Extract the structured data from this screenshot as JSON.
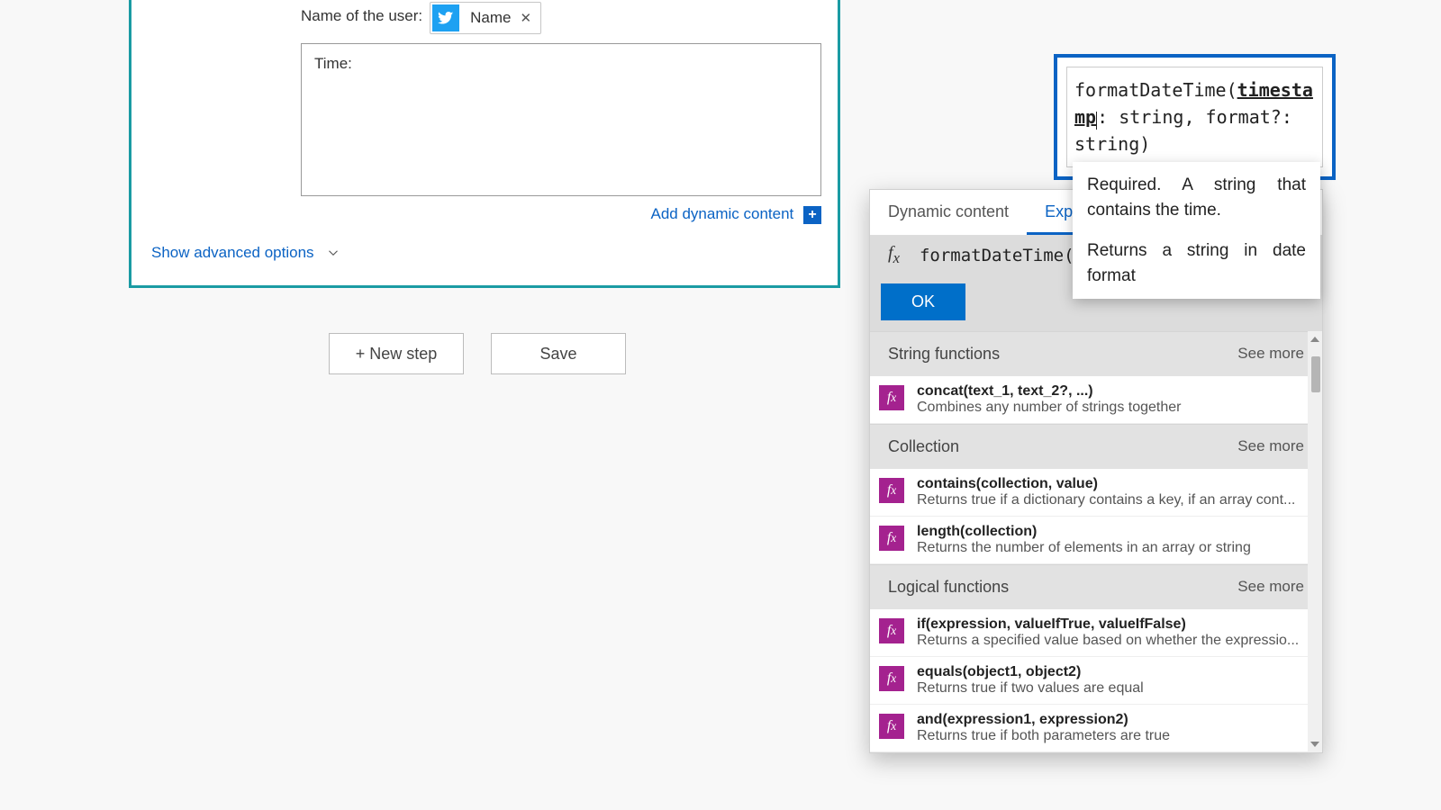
{
  "card": {
    "user_label": "Name of the user:",
    "token_label": "Name",
    "time_label": "Time:",
    "dyn_link": "Add dynamic content",
    "advanced": "Show advanced options"
  },
  "buttons": {
    "new_step": "+ New step",
    "save": "Save"
  },
  "panel": {
    "tab_dynamic": "Dynamic content",
    "tab_expression": "Expression",
    "expr_value": "formatDateTime(",
    "ok": "OK",
    "see_more": "See more",
    "groups": [
      {
        "name": "String functions",
        "items": [
          {
            "sig": "concat(text_1, text_2?, ...)",
            "desc": "Combines any number of strings together"
          }
        ]
      },
      {
        "name": "Collection",
        "items": [
          {
            "sig": "contains(collection, value)",
            "desc": "Returns true if a dictionary contains a key, if an array cont..."
          },
          {
            "sig": "length(collection)",
            "desc": "Returns the number of elements in an array or string"
          }
        ]
      },
      {
        "name": "Logical functions",
        "items": [
          {
            "sig": "if(expression, valueIfTrue, valueIfFalse)",
            "desc": "Returns a specified value based on whether the expressio..."
          },
          {
            "sig": "equals(object1, object2)",
            "desc": "Returns true if two values are equal"
          },
          {
            "sig": "and(expression1, expression2)",
            "desc": "Returns true if both parameters are true"
          }
        ]
      }
    ]
  },
  "signature": {
    "func": "formatDateTime",
    "p1": "timestamp",
    "p1_type": "string",
    "p2": "format?",
    "p2_type": "string"
  },
  "help": {
    "required": "Required. A string that contains the time.",
    "returns": "Returns a string in date format"
  }
}
